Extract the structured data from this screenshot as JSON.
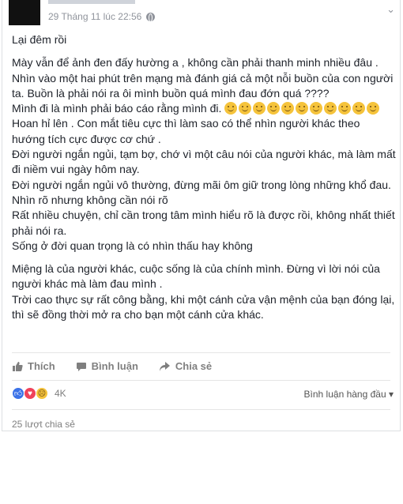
{
  "header": {
    "timestamp": "29 Tháng 11 lúc 22:56",
    "icon": "globe-icon",
    "menu_icon": "chevron-down-icon"
  },
  "post": {
    "lines": [
      "Lại đêm rồi",
      "Mày vẫn để ảnh đen đấy hường a , không cần phải thanh minh nhiều đâu .",
      "Nhìn vào một hai phút trên mạng mà đánh giá cả một nỗi buồn của con người ta. Buồn là phải nói ra ôi mình buồn quá mình đau đớn quá ????",
      "Mình đi là mình phải báo cáo rằng mình đi.",
      "Hoan hỉ lên . Con mắt tiêu cực thì làm sao có thể nhìn người khác theo hướng tích cực được cơ chứ .",
      "Đời người ngắn ngủi, tạm bợ, chớ vì một câu nói của người khác, mà làm mất đi niềm vui ngày hôm nay.",
      "Đời người ngắn ngủi vô thường, đừng mãi ôm giữ trong lòng những khổ đau.",
      "Nhìn rõ nhưng không cần nói rõ",
      "Rất nhiều chuyện, chỉ cần trong tâm mình hiểu rõ là được rồi, không nhất thiết phải nói ra.",
      "Sống ở đời quan trọng là có nhìn thấu hay không",
      "Miệng là của người khác, cuộc sống là của chính mình. Đừng vì lời nói của người khác mà làm đau mình .",
      "Trời cao thực sự rất công bằng, khi một cánh cửa vận mệnh của bạn đóng lại, thì sẽ đồng thời mở ra cho bạn một cánh cửa khác."
    ],
    "emoji_count": 11
  },
  "actions": {
    "like": "Thích",
    "comment": "Bình luận",
    "share": "Chia sẻ"
  },
  "reactions": {
    "count": "4K",
    "sort_label": "Bình luận hàng đầu",
    "types": [
      "like",
      "love",
      "sad"
    ]
  },
  "shares": {
    "label": "25 lượt chia sẻ"
  }
}
